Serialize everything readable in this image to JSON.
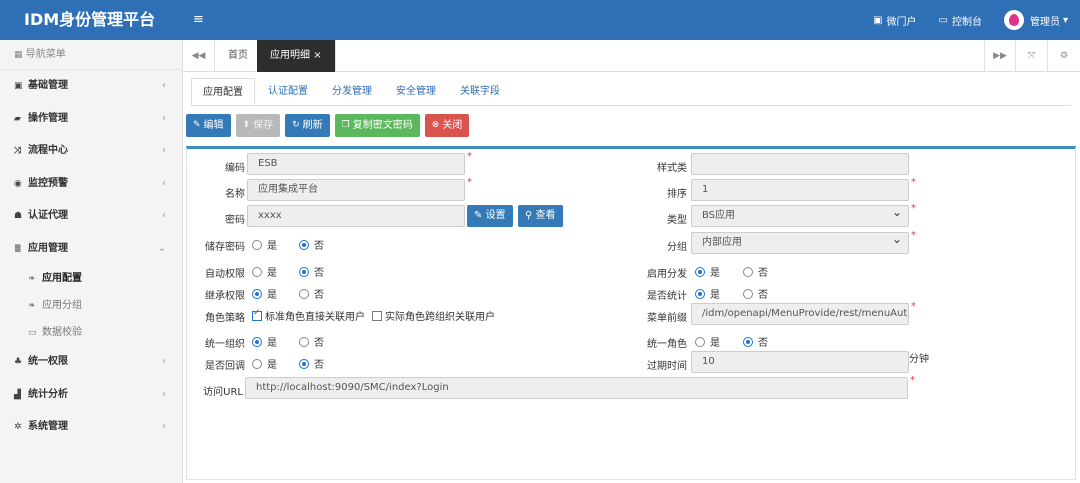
{
  "app_title": "IDM身份管理平台",
  "header": {
    "menu_toggle": "≡",
    "portal": "微门户",
    "console": "控制台",
    "user": "管理员"
  },
  "sidebar": {
    "nav_label": "导航菜单",
    "items": [
      {
        "label": "基础管理"
      },
      {
        "label": "操作管理"
      },
      {
        "label": "流程中心"
      },
      {
        "label": "监控预警"
      },
      {
        "label": "认证代理"
      },
      {
        "label": "应用管理"
      }
    ],
    "sub_items": [
      {
        "label": "应用配置"
      },
      {
        "label": "应用分组"
      },
      {
        "label": "数据校验"
      }
    ],
    "items2": [
      {
        "label": "统一权限"
      },
      {
        "label": "统计分析"
      },
      {
        "label": "系统管理"
      }
    ]
  },
  "tabs": {
    "home": "首页",
    "active": "应用明细",
    "close": "×"
  },
  "subtabs": [
    "应用配置",
    "认证配置",
    "分发管理",
    "安全管理",
    "关联字段"
  ],
  "actions": {
    "edit": "编辑",
    "save": "保存",
    "refresh": "刷新",
    "copy": "复制密文密码",
    "close": "关闭"
  },
  "form": {
    "code_label": "编码",
    "code_value": "ESB",
    "name_label": "名称",
    "name_value": "应用集成平台",
    "password_label": "密码",
    "password_value": "xxxx",
    "set_button": "设置",
    "view_button": "查看",
    "store_pwd_label": "储存密码",
    "auto_perm_label": "自动权限",
    "inherit_perm_label": "继承权限",
    "role_policy_label": "角色策略",
    "role_opt1": "标准角色直接关联用户",
    "role_opt2": "实际角色跨组织关联用户",
    "unify_org_label": "统一组织",
    "callback_label": "是否回调",
    "url_label": "访问URL",
    "url_value": "http://localhost:9090/SMC/index?Login",
    "style_label": "样式类",
    "style_value": "",
    "order_label": "排序",
    "order_value": "1",
    "type_label": "类型",
    "type_value": "BS应用",
    "group_label": "分组",
    "group_value": "内部应用",
    "enable_dist_label": "启用分发",
    "stats_label": "是否统计",
    "menu_prefix_label": "菜单前缀",
    "menu_prefix_value": "/idm/openapi/MenuProvide/rest/menuAut",
    "unify_role_label": "统一角色",
    "expire_label": "过期时间",
    "expire_value": "10",
    "expire_unit": "分钟",
    "yes": "是",
    "no": "否"
  },
  "colors": {
    "topbar": "#2f6fb5",
    "primary": "#337ab7",
    "success": "#5cb85c",
    "danger": "#d9534f"
  }
}
